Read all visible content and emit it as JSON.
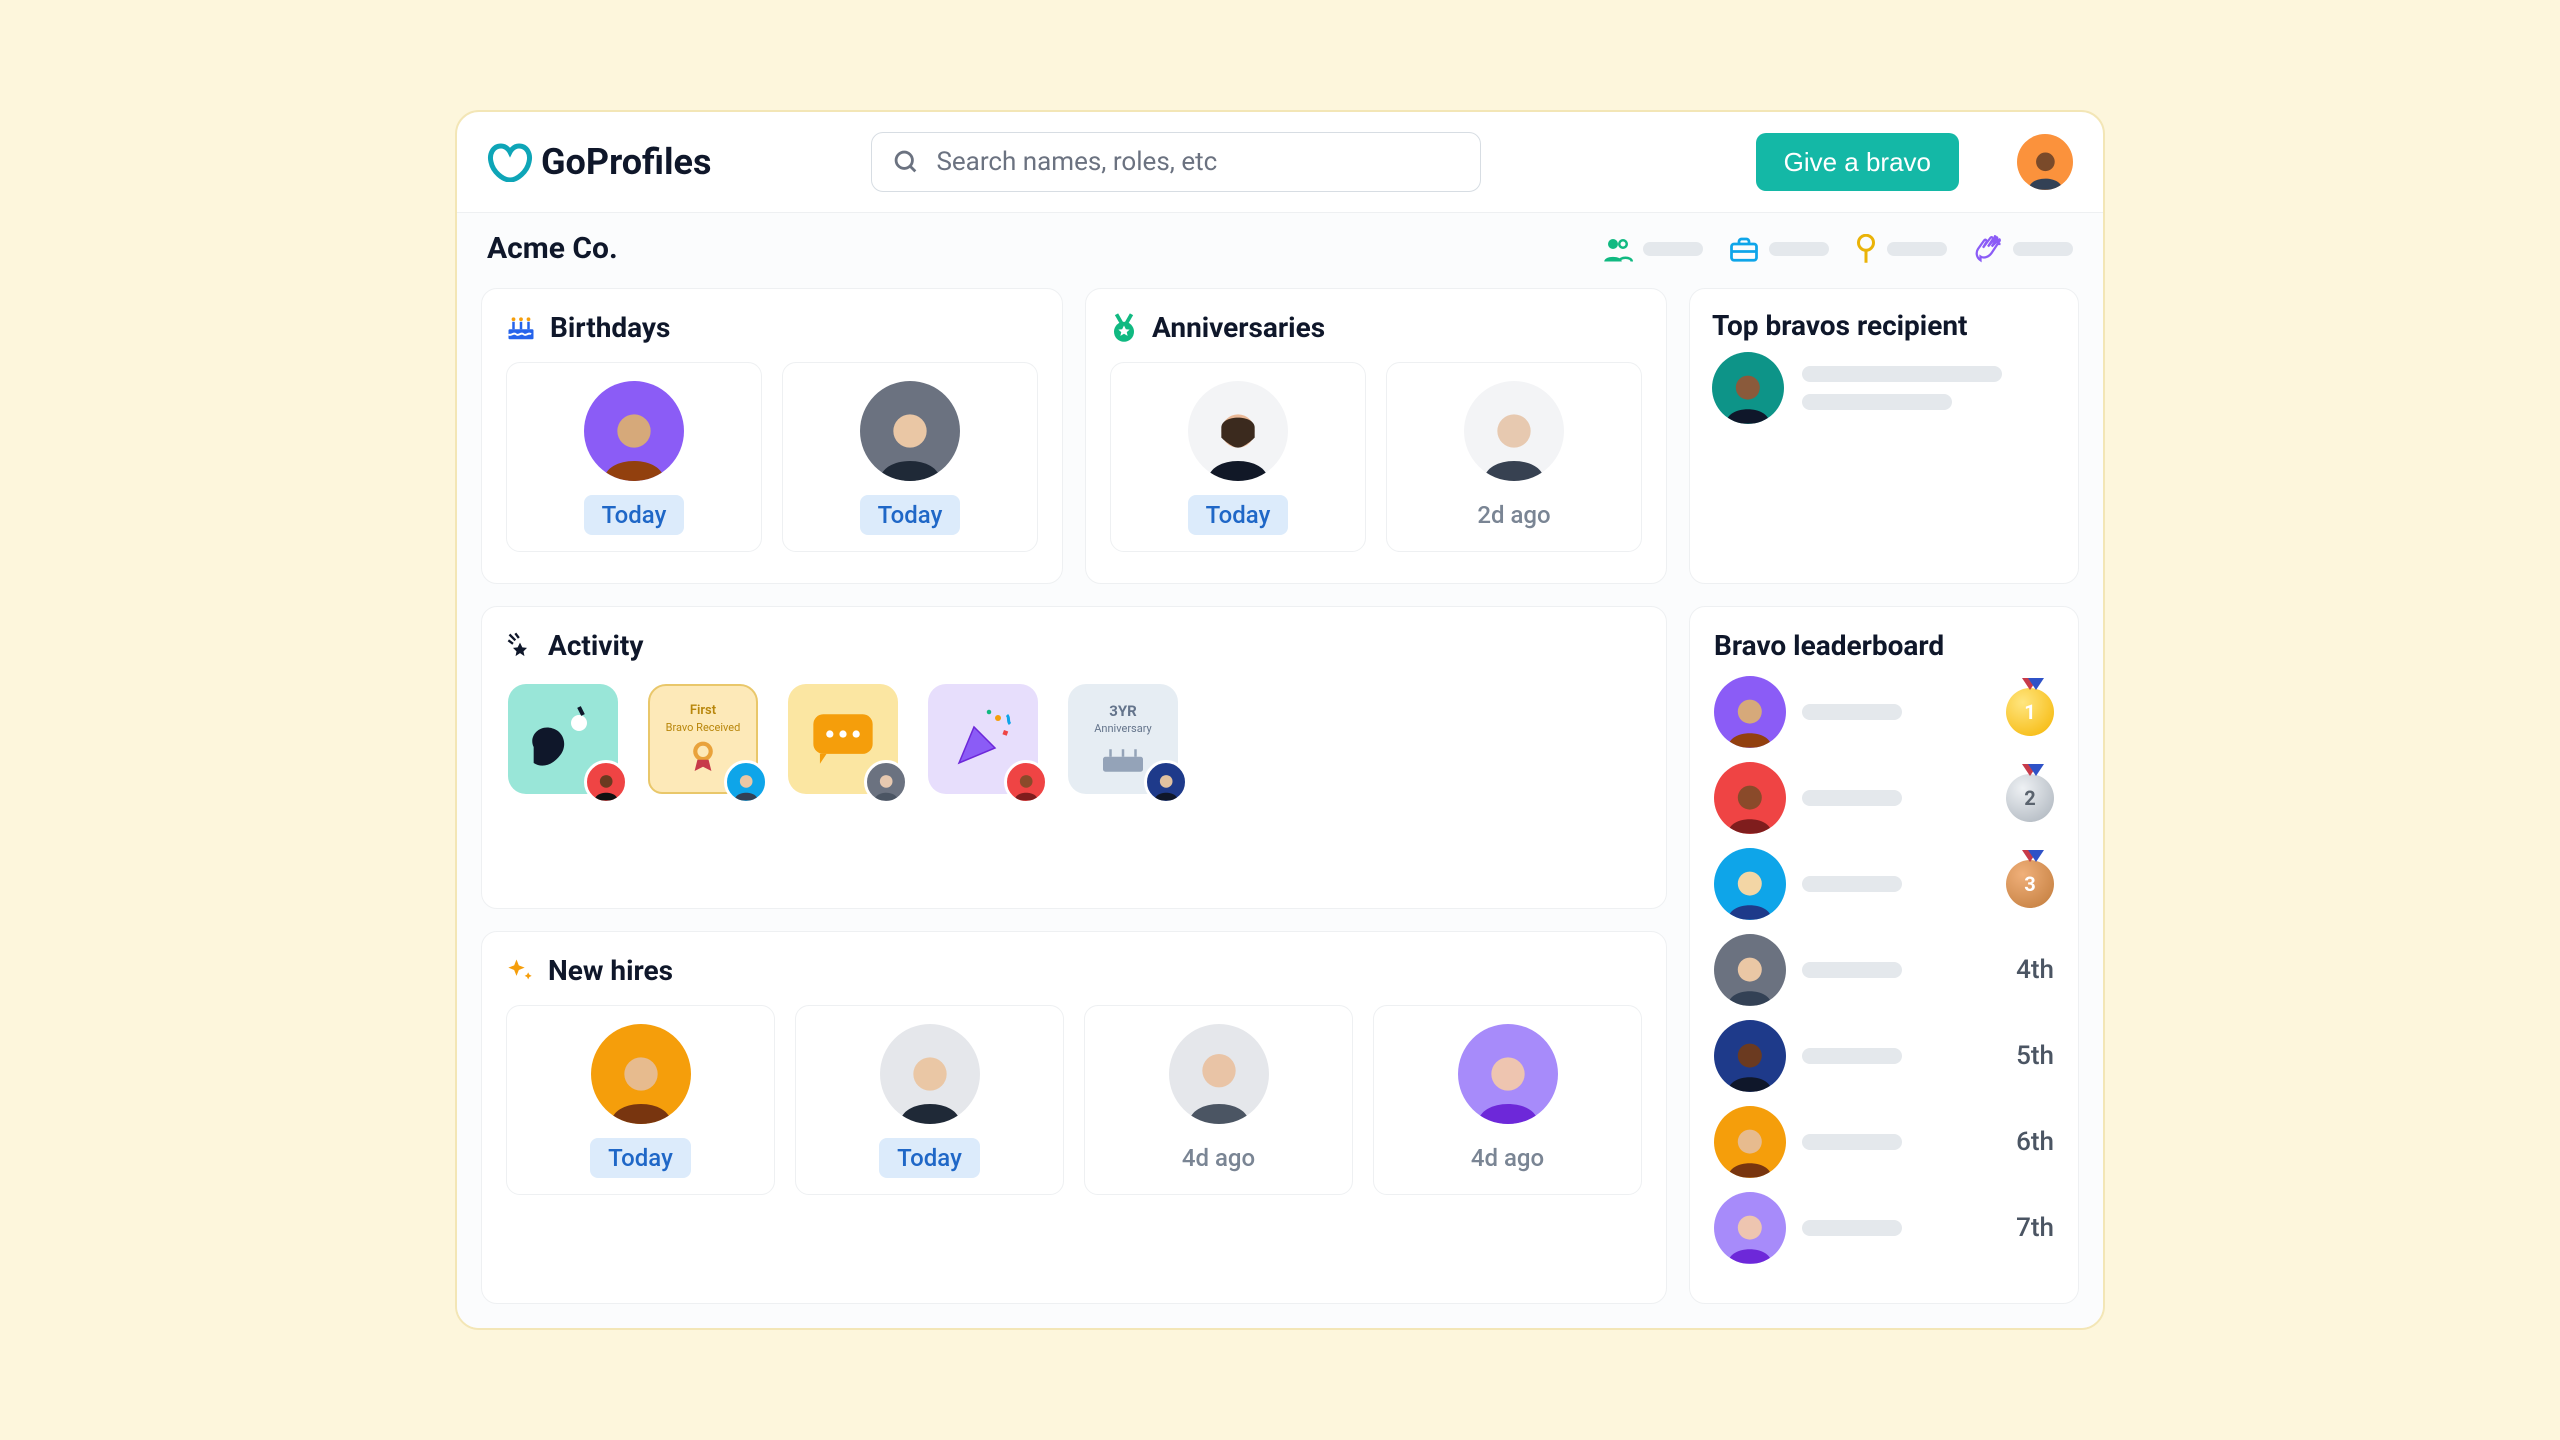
{
  "brand": {
    "name": "GoProfiles"
  },
  "header": {
    "search_placeholder": "Search names, roles, etc",
    "give_bravo_label": "Give a bravo"
  },
  "company": {
    "name": "Acme Co."
  },
  "stat_icons": [
    "people",
    "briefcase",
    "location-pin",
    "clap"
  ],
  "cards": {
    "birthdays": {
      "title": "Birthdays",
      "people": [
        {
          "badge": "Today",
          "badge_style": "blue"
        },
        {
          "badge": "Today",
          "badge_style": "blue"
        }
      ]
    },
    "anniversaries": {
      "title": "Anniversaries",
      "people": [
        {
          "badge": "Today",
          "badge_style": "blue"
        },
        {
          "badge": "2d ago",
          "badge_style": "gray"
        }
      ]
    },
    "top_bravos": {
      "title": "Top bravos recipient"
    },
    "activity": {
      "title": "Activity",
      "items": [
        {
          "kind": "bravo-art",
          "label": ""
        },
        {
          "kind": "first-bravo-badge",
          "label": "First",
          "sub": "Bravo Received"
        },
        {
          "kind": "chat",
          "label": ""
        },
        {
          "kind": "confetti",
          "label": ""
        },
        {
          "kind": "anniversary-3yr",
          "label": "3YR",
          "sub": "Anniversary"
        }
      ]
    },
    "new_hires": {
      "title": "New hires",
      "people": [
        {
          "badge": "Today",
          "badge_style": "blue"
        },
        {
          "badge": "Today",
          "badge_style": "blue"
        },
        {
          "badge": "4d ago",
          "badge_style": "gray"
        },
        {
          "badge": "4d ago",
          "badge_style": "gray"
        }
      ]
    },
    "leaderboard": {
      "title": "Bravo leaderboard",
      "rows": [
        {
          "rank": "1",
          "medal": "gold"
        },
        {
          "rank": "2",
          "medal": "silver"
        },
        {
          "rank": "3",
          "medal": "bronze"
        },
        {
          "rank": "4th"
        },
        {
          "rank": "5th"
        },
        {
          "rank": "6th"
        },
        {
          "rank": "7th"
        }
      ]
    }
  }
}
